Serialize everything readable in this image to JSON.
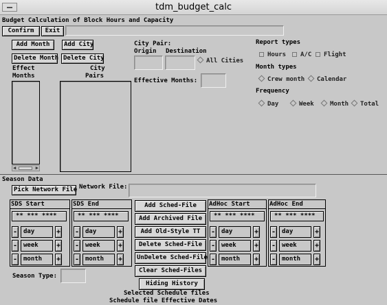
{
  "window": {
    "title": "tdm_budget_calc"
  },
  "header": {
    "subtitle": "Budget Calculation of Block Hours and Capacity"
  },
  "toolbar": {
    "confirm_label": "Confirm",
    "exit_label": "Exit",
    "status_value": ""
  },
  "left": {
    "add_month": "Add Month",
    "add_city": "Add City",
    "delete_month": "Delete Month",
    "delete_city": "Delete City",
    "effect_months_label_1": "Effect",
    "effect_months_label_2": "Months",
    "city_pairs_label_1": "City",
    "city_pairs_label_2": "Pairs"
  },
  "city_pair": {
    "label": "City Pair:",
    "origin_label": "Origin",
    "destination_label": "Destination",
    "origin_value": "",
    "destination_value": "",
    "all_cities_label": "All Cities",
    "effective_months_label": "Effective Months:",
    "effective_months_value": ""
  },
  "report": {
    "types_label": "Report types",
    "hours": "Hours",
    "ac": "A/C",
    "flight": "Flight",
    "month_types_label": "Month types",
    "crew_month": "Crew month",
    "calendar": "Calendar",
    "frequency_label": "Frequency",
    "day": "Day",
    "week": "Week",
    "month": "Month",
    "total": "Total"
  },
  "season": {
    "title": "Season Data",
    "pick_network_file": "Pick Network File",
    "network_file_label": "Network File:",
    "network_file_value": "",
    "sds_start": "SDS Start",
    "sds_end": "SDS End",
    "adhoc_start": "AdHoc Start",
    "adhoc_end": "AdHoc End",
    "date_placeholder": "** *** ****",
    "minus": "-",
    "plus": "+",
    "day": "day",
    "week": "week",
    "month": "month",
    "season_type_label": "Season Type:",
    "season_type_value": ""
  },
  "sched": {
    "add_sched_file": "Add Sched-File",
    "add_archived_file": "Add Archived File",
    "add_old_style_tt": "Add Old-Style TT",
    "delete_sched_file": "Delete Sched-File",
    "undelete_sched_file": "UnDelete Sched-File",
    "clear_sched_files": "Clear Sched-Files",
    "hiding_history": "Hiding History",
    "selected_label": "Selected Schedule files",
    "columns_label": "Schedule file   Effective Dates"
  }
}
